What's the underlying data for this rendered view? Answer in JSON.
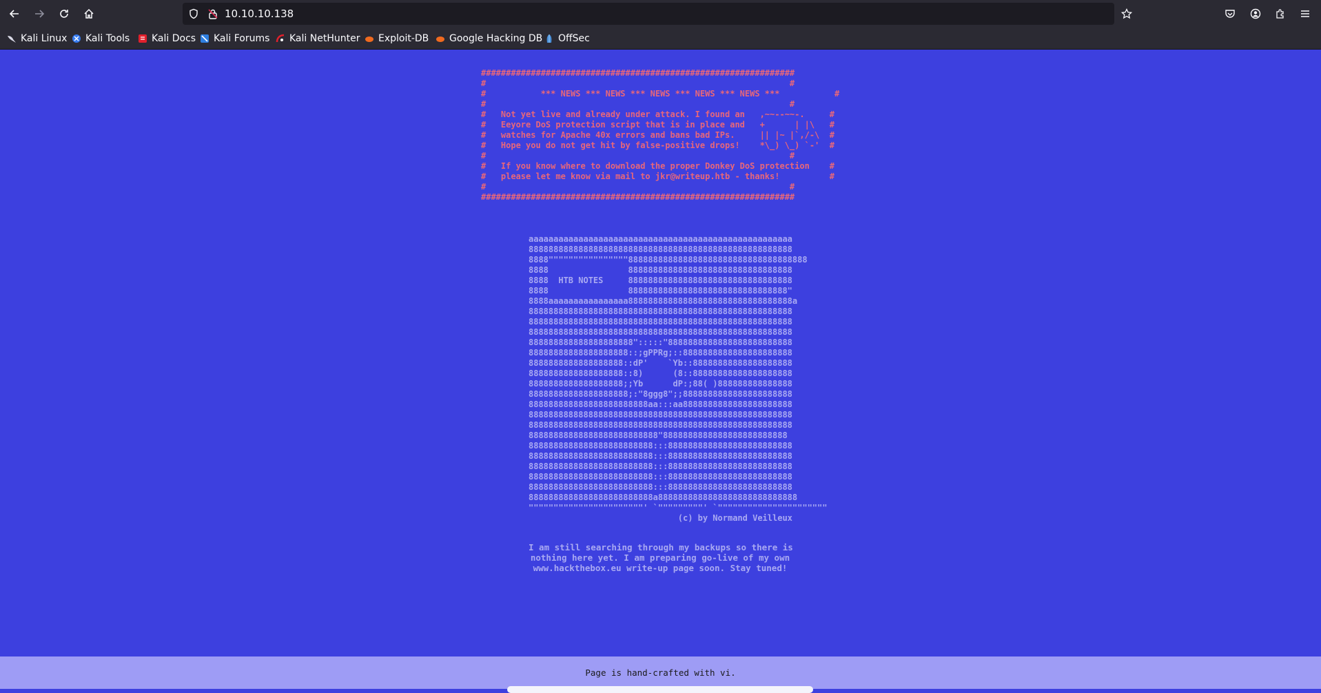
{
  "browser": {
    "url": "10.10.10.138",
    "bookmarks": [
      {
        "label": "Kali Linux",
        "icon": "kali-dragon-icon"
      },
      {
        "label": "Kali Tools",
        "icon": "kali-tools-icon"
      },
      {
        "label": "Kali Docs",
        "icon": "kali-docs-icon"
      },
      {
        "label": "Kali Forums",
        "icon": "kali-forums-icon"
      },
      {
        "label": "Kali NetHunter",
        "icon": "nethunter-icon"
      },
      {
        "label": "Exploit-DB",
        "icon": "exploitdb-icon"
      },
      {
        "label": "Google Hacking DB",
        "icon": "ghdb-icon"
      },
      {
        "label": "OffSec",
        "icon": "offsec-icon"
      }
    ],
    "colors": {
      "chrome": "#2b2a33",
      "urlbar": "#1c1b22",
      "text": "#fbfbfe"
    }
  },
  "page": {
    "news_ascii": "###############################################################\n#                                                             #\n#           *** NEWS *** NEWS *** NEWS *** NEWS *** NEWS ***           #\n#                                                             #\n#   Not yet live and already under attack. I found an   ,~~--~~-.     #\n#   Eeyore DoS protection script that is in place and   +      | |\\   #\n#   watches for Apache 40x errors and bans bad IPs.     || |~ |`,/-\\  #\n#   Hope you do not get hit by false-positive drops!    *\\_) \\_) `-'  #\n#                                                             #\n#   If you know where to download the proper Donkey DoS protection    #\n#   please let me know via mail to jkr@writeup.htb - thanks!          #\n#                                                             #\n###############################################################",
    "htb_ascii": "aaaaaaaaaaaaaaaaaaaaaaaaaaaaaaaaaaaaaaaaaaaaaaaaaaaaa\n88888888888888888888888888888888888888888888888888888\n8888\"\"\"\"\"\"\"\"\"\"\"\"\"\"\"\"888888888888888888888888888888888888\n8888                888888888888888888888888888888888\n8888  HTB NOTES     888888888888888888888888888888888\n8888                88888888888888888888888888888888\"\n8888aaaaaaaaaaaaaaaa888888888888888888888888888888888a\n88888888888888888888888888888888888888888888888888888\n88888888888888888888888888888888888888888888888888888\n88888888888888888888888888888888888888888888888888888\n888888888888888888888\":::::\"8888888888888888888888888\n88888888888888888888::;gPPRg;::8888888888888888888888\n8888888888888888888::dP'    `Yb::88888888888888888888\n8888888888888888888::8)      (8::88888888888888888888\n8888888888888888888;;Yb      dP:;88( )888888888888888\n88888888888888888888;:\"8ggg8\";;8888888888888888888888\n888888888888888888888888aa:::aa8888888888888888888888\n88888888888888888888888888888888888888888888888888888\n88888888888888888888888888888888888888888888888888888\n88888888888888888888888888\"8888888888888888888888888\n8888888888888888888888888:::8888888888888888888888888\n8888888888888888888888888:::8888888888888888888888888\n8888888888888888888888888:::8888888888888888888888888\n8888888888888888888888888:::8888888888888888888888888\n8888888888888888888888888:::8888888888888888888888888\n8888888888888888888888888a8888888888888888888888888888\n\"\"\"\"\"\"\"\"\"\"\"\"\"\"\"\"\"\"\"\"\"\"\"' `\"\"\"\"\"\"\"\"\"' `\"\"\"\"\"\"\"\"\"\"\"\"\"\"\"\"\"\"\"\"\"\"\n                              (c) by Normand Veilleux",
    "backup_lines": [
      "I am still searching through my backups so there is",
      "nothing here yet. I am preparing go-live of my own",
      "www.hackthebox.eu write-up page soon. Stay tuned!"
    ],
    "footer_text": "Page is hand-crafted with vi.",
    "colors": {
      "background": "#3d40df",
      "news": "#e8677a",
      "ascii": "#a9a9f2",
      "footer": "#9e9cf5"
    }
  }
}
